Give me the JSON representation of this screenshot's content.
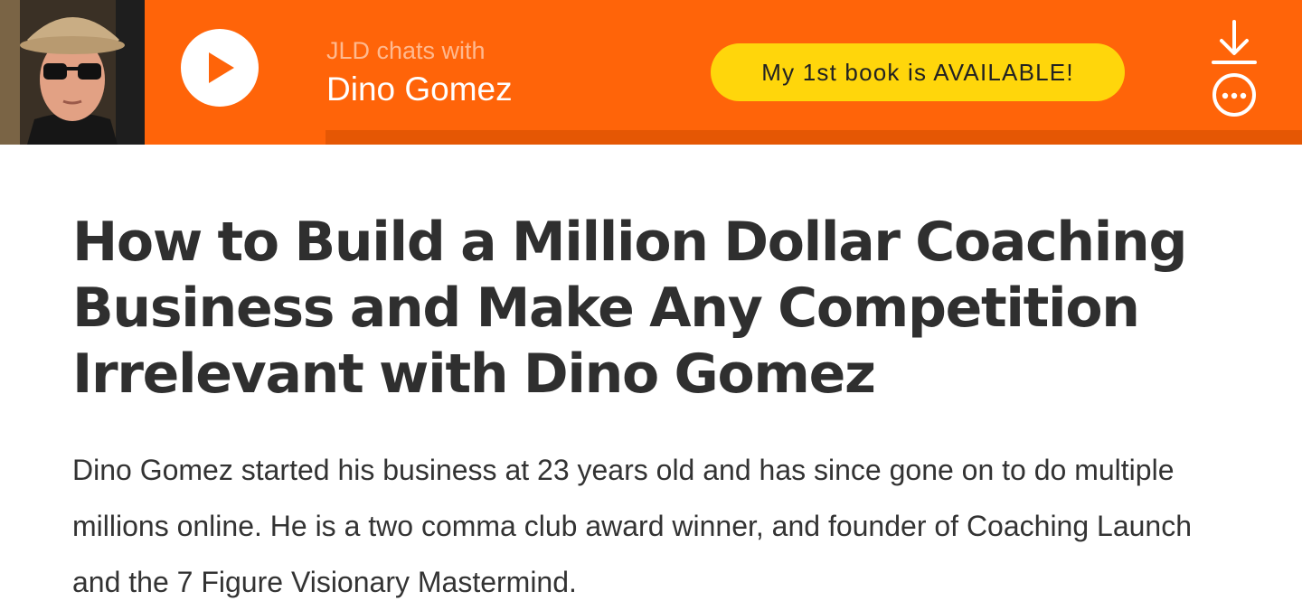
{
  "player": {
    "kicker": "JLD chats with",
    "guest_name": "Dino Gomez",
    "book_cta": "My 1st book is AVAILABLE!",
    "progress": 0,
    "icons": {
      "play": "play-icon",
      "download": "download-icon",
      "more": "more-options-icon"
    },
    "colors": {
      "bar": "#ff6409",
      "accent_button": "#ffd60b",
      "track": "#e55704"
    }
  },
  "article": {
    "title": "How to Build a Million Dollar Coaching Business and Make Any Competition Irrelevant with Dino Gomez",
    "summary": "Dino Gomez started his business at 23 years old and has since gone on to do multiple millions online. He is a two comma club award winner, and founder of Coaching Launch and the 7 Figure Visionary Mastermind."
  }
}
